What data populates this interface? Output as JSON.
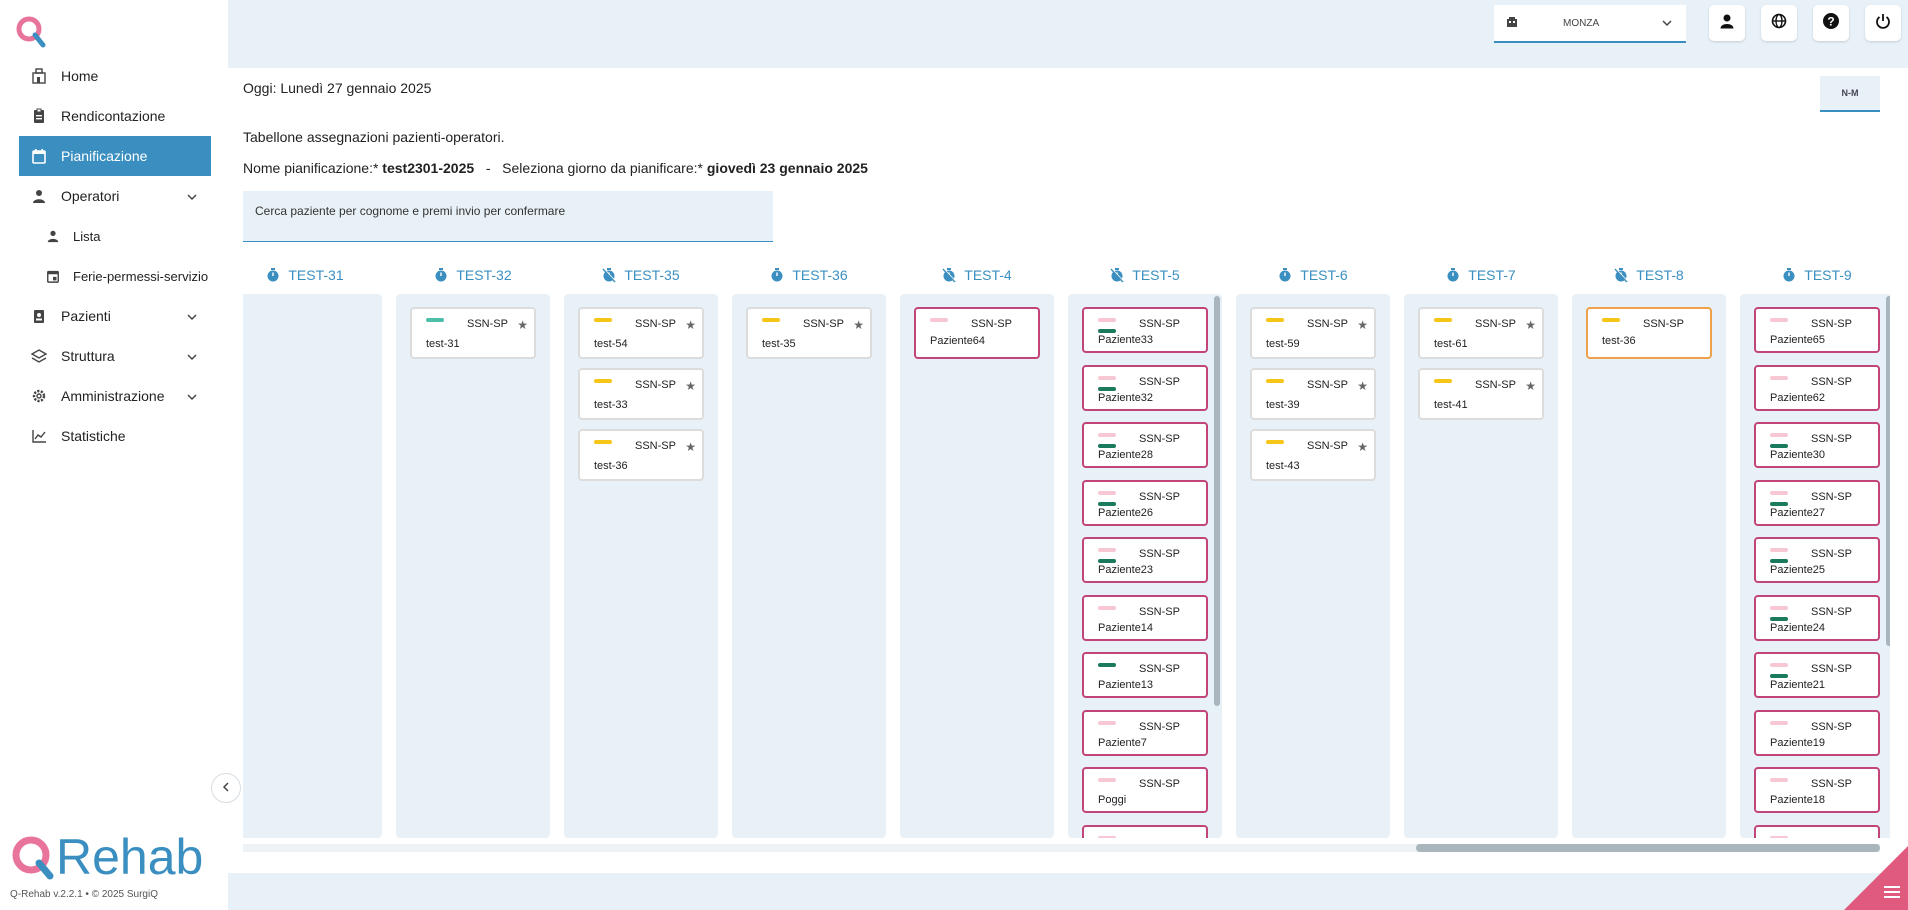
{
  "sidebar": {
    "items": [
      {
        "label": "Home",
        "icon": "home-icon"
      },
      {
        "label": "Rendicontazione",
        "icon": "clipboard-icon"
      },
      {
        "label": "Pianificazione",
        "icon": "calendar-icon",
        "active": true
      },
      {
        "label": "Operatori",
        "icon": "operator-icon"
      },
      {
        "label": "Lista",
        "icon": "person-icon"
      },
      {
        "label": "Ferie-permessi-servizio",
        "icon": "calendar-check-icon"
      },
      {
        "label": "Pazienti",
        "icon": "patient-icon"
      },
      {
        "label": "Struttura",
        "icon": "layers-icon"
      },
      {
        "label": "Amministrazione",
        "icon": "gear-icon"
      },
      {
        "label": "Statistiche",
        "icon": "chart-line-icon"
      }
    ],
    "brand": "Rehab",
    "version": "Q-Rehab v.2.2.1 • © 2025 SurgiQ"
  },
  "topbar": {
    "site": "MONZA"
  },
  "main": {
    "today_label": "Oggi:  Lunedì 27 gennaio 2025",
    "nm_button": "N-M",
    "line1": "Tabellone assegnazioni pazienti-operatori.",
    "plan_label": "Nome pianificazione:*",
    "plan_name": "test2301-2025",
    "separator": "-",
    "day_label": "Seleziona giorno da pianificare:*",
    "day_value": "giovedì 23 gennaio 2025",
    "search_placeholder": "Cerca paziente per cognome e premi invio per confermare"
  },
  "colors": {
    "accent": "#3b8fc0",
    "pink_border": "#c2457a",
    "orange_border": "#f0a04b",
    "yellow_bar": "#f5c518",
    "teal_bar": "#4dbfa8",
    "dark_teal_bar": "#1a7a5e",
    "light_pink_bar": "#f7c8d4"
  },
  "columns": [
    {
      "name": "TEST-31",
      "cards": []
    },
    {
      "name": "TEST-32",
      "cards": [
        {
          "code": "SSN-SP",
          "name": "test-31",
          "bar": "teal",
          "border": "grey",
          "star": "★"
        }
      ]
    },
    {
      "name": "TEST-35",
      "cards": [
        {
          "code": "SSN-SP",
          "name": "test-54",
          "bar": "yellow",
          "border": "grey",
          "star": "★"
        },
        {
          "code": "SSN-SP",
          "name": "test-33",
          "bar": "yellow",
          "border": "grey",
          "star": "★"
        },
        {
          "code": "SSN-SP",
          "name": "test-36",
          "bar": "yellow",
          "border": "grey",
          "star": "★"
        }
      ]
    },
    {
      "name": "TEST-36",
      "cards": [
        {
          "code": "SSN-SP",
          "name": "test-35",
          "bar": "yellow",
          "border": "grey",
          "star": "★"
        }
      ]
    },
    {
      "name": "TEST-4",
      "cards": [
        {
          "code": "SSN-SP",
          "name": "Paziente64",
          "bar": "light_pink",
          "border": "pink",
          "star": ""
        }
      ]
    },
    {
      "name": "TEST-5",
      "cards": [
        {
          "code": "SSN-SP",
          "name": "Paziente33",
          "bar": "light_pink_dark",
          "border": "pink",
          "star": ""
        },
        {
          "code": "SSN-SP",
          "name": "Paziente32",
          "bar": "light_pink_dark",
          "border": "pink",
          "star": ""
        },
        {
          "code": "SSN-SP",
          "name": "Paziente28",
          "bar": "light_pink_dark",
          "border": "pink",
          "star": ""
        },
        {
          "code": "SSN-SP",
          "name": "Paziente26",
          "bar": "light_pink_dark",
          "border": "pink",
          "star": ""
        },
        {
          "code": "SSN-SP",
          "name": "Paziente23",
          "bar": "light_pink_dark",
          "border": "pink",
          "star": ""
        },
        {
          "code": "SSN-SP",
          "name": "Paziente14",
          "bar": "light_pink",
          "border": "pink",
          "star": ""
        },
        {
          "code": "SSN-SP",
          "name": "Paziente13",
          "bar": "dark_teal",
          "border": "pink",
          "star": ""
        },
        {
          "code": "SSN-SP",
          "name": "Paziente7",
          "bar": "light_pink",
          "border": "pink",
          "star": ""
        },
        {
          "code": "SSN-SP",
          "name": "Poggi",
          "bar": "light_pink",
          "border": "pink",
          "star": ""
        },
        {
          "code": "",
          "name": "",
          "bar": "light_pink",
          "border": "pink",
          "star": ""
        }
      ]
    },
    {
      "name": "TEST-6",
      "cards": [
        {
          "code": "SSN-SP",
          "name": "test-59",
          "bar": "yellow",
          "border": "grey",
          "star": "★"
        },
        {
          "code": "SSN-SP",
          "name": "test-39",
          "bar": "yellow",
          "border": "grey",
          "star": "★"
        },
        {
          "code": "SSN-SP",
          "name": "test-43",
          "bar": "yellow",
          "border": "grey",
          "star": "★"
        }
      ]
    },
    {
      "name": "TEST-7",
      "cards": [
        {
          "code": "SSN-SP",
          "name": "test-61",
          "bar": "yellow",
          "border": "grey",
          "star": "★"
        },
        {
          "code": "SSN-SP",
          "name": "test-41",
          "bar": "yellow",
          "border": "grey",
          "star": "★"
        }
      ]
    },
    {
      "name": "TEST-8",
      "cards": [
        {
          "code": "SSN-SP",
          "name": "test-36",
          "bar": "yellow",
          "border": "orange",
          "star": ""
        }
      ]
    },
    {
      "name": "TEST-9",
      "cards": [
        {
          "code": "SSN-SP",
          "name": "Paziente65",
          "bar": "light_pink",
          "border": "pink",
          "star": ""
        },
        {
          "code": "SSN-SP",
          "name": "Paziente62",
          "bar": "light_pink",
          "border": "pink",
          "star": ""
        },
        {
          "code": "SSN-SP",
          "name": "Paziente30",
          "bar": "light_pink_dark",
          "border": "pink",
          "star": ""
        },
        {
          "code": "SSN-SP",
          "name": "Paziente27",
          "bar": "light_pink_dark",
          "border": "pink",
          "star": ""
        },
        {
          "code": "SSN-SP",
          "name": "Paziente25",
          "bar": "light_pink_dark",
          "border": "pink",
          "star": ""
        },
        {
          "code": "SSN-SP",
          "name": "Paziente24",
          "bar": "light_pink_dark",
          "border": "pink",
          "star": ""
        },
        {
          "code": "SSN-SP",
          "name": "Paziente21",
          "bar": "light_pink_dark",
          "border": "pink",
          "star": ""
        },
        {
          "code": "SSN-SP",
          "name": "Paziente19",
          "bar": "light_pink",
          "border": "pink",
          "star": ""
        },
        {
          "code": "SSN-SP",
          "name": "Paziente18",
          "bar": "light_pink",
          "border": "pink",
          "star": ""
        },
        {
          "code": "",
          "name": "",
          "bar": "light_pink",
          "border": "pink",
          "star": ""
        }
      ]
    }
  ]
}
